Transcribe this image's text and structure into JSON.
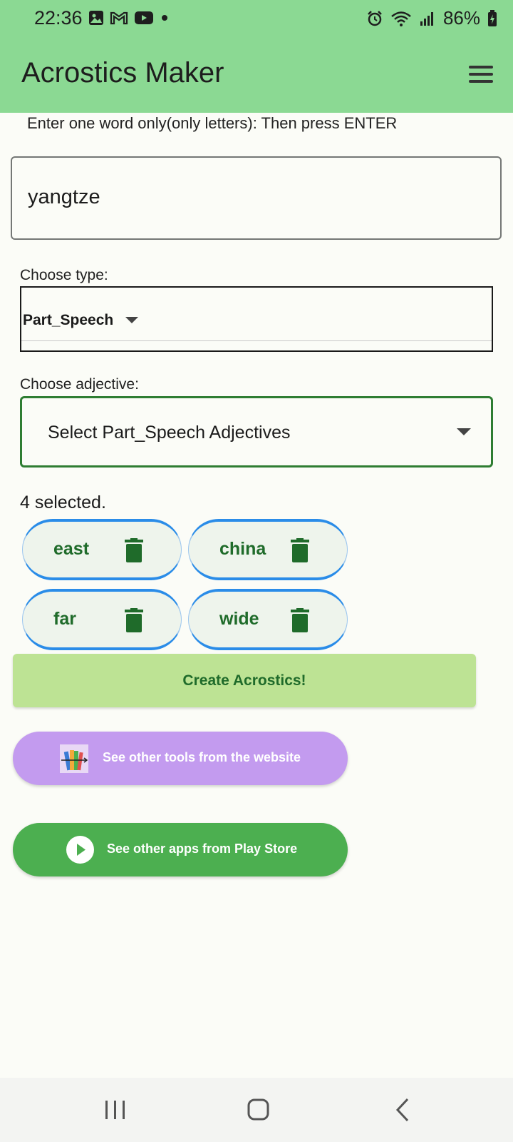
{
  "status_bar": {
    "time": "22:36",
    "battery": "86%",
    "left_icons": [
      "image-icon",
      "gmail-icon",
      "youtube-icon",
      "dot-icon"
    ],
    "right_icons": [
      "alarm-icon",
      "wifi-icon",
      "signal-icon",
      "battery-icon"
    ]
  },
  "app_bar": {
    "title": "Acrostics Maker",
    "menu_icon": "hamburger-menu-icon",
    "color": "#8BD993"
  },
  "word_entry": {
    "instruction": "Enter one word only(only letters): Then press ENTER",
    "value": "yangtze"
  },
  "type_select": {
    "label": "Choose type:",
    "value": "Part_Speech"
  },
  "adjective_select": {
    "label": "Choose adjective:",
    "placeholder": "Select Part_Speech Adjectives",
    "border_color": "#2E7D32"
  },
  "selection": {
    "count_text": "4 selected.",
    "chips": [
      {
        "label": "east"
      },
      {
        "label": "china"
      },
      {
        "label": "far"
      },
      {
        "label": "wide"
      }
    ],
    "chip_text_color": "#1F6B2A",
    "chip_border_color": "#2A8CE8"
  },
  "actions": {
    "create_label": "Create Acrostics!",
    "create_color": "#BDE394",
    "tools_label": "See other tools from the website",
    "tools_color": "#C39BEF",
    "play_label": "See other apps from Play Store",
    "play_color": "#4CAF50"
  },
  "nav_bar": {
    "items": [
      "recent-apps-icon",
      "home-icon",
      "back-icon"
    ]
  }
}
